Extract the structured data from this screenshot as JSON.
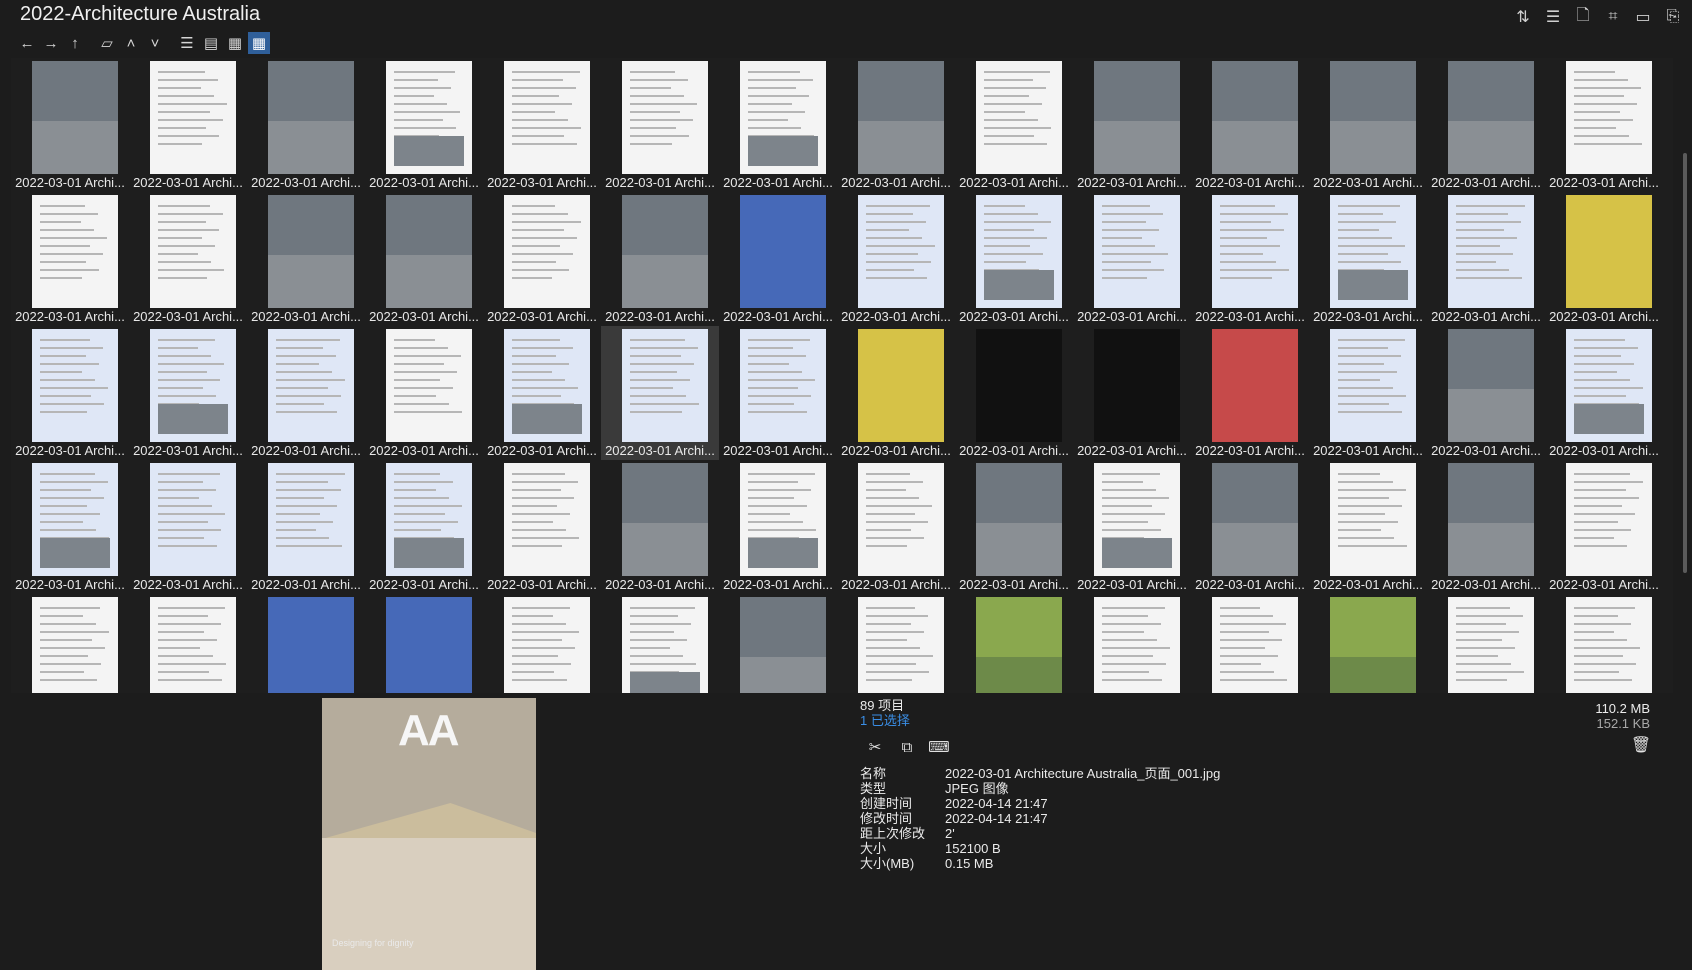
{
  "window": {
    "title": "2022-Architecture Australia",
    "controls": [
      "sort-icon",
      "list-properties-icon",
      "new-file-icon",
      "crop-icon",
      "panel-icon",
      "clipboard-icon"
    ]
  },
  "toolbar": {
    "buttons": [
      "back-arrow-icon",
      "forward-arrow-icon",
      "up-arrow-icon",
      "folder-icon",
      "chevron-up-icon",
      "chevron-down-icon",
      "list-view-icon",
      "detail-view-icon",
      "tree-view-icon",
      "thumbnail-view-icon"
    ]
  },
  "grid": {
    "label": "2022-03-01 Archi...",
    "rows": [
      [
        "photo",
        "white",
        "photo",
        "white",
        "white",
        "white",
        "white",
        "photo",
        "white",
        "photo",
        "photo",
        "photo",
        "photo",
        "white"
      ],
      [
        "white",
        "white",
        "photo",
        "photo",
        "white",
        "photo",
        "navy",
        "blue",
        "blue",
        "blue",
        "blue",
        "blue",
        "blue",
        "yellow"
      ],
      [
        "blue",
        "blue",
        "blue",
        "white",
        "blue",
        "blue",
        "blue",
        "yellow",
        "dark",
        "dark",
        "red",
        "blue",
        "photo",
        "blue"
      ],
      [
        "blue",
        "blue",
        "blue",
        "blue",
        "white",
        "photo",
        "white",
        "white",
        "photo",
        "white",
        "photo",
        "white",
        "photo",
        "white"
      ],
      [
        "white",
        "white",
        "navy",
        "navy",
        "white",
        "white",
        "photo",
        "white",
        "green",
        "white",
        "white",
        "green",
        "white",
        "white"
      ]
    ],
    "visible_labels_rows": 4,
    "selected": {
      "row": 2,
      "col": 5
    }
  },
  "preview": {
    "logo": "AA",
    "caption": "Designing for dignity"
  },
  "info": {
    "count": "89 项目",
    "selected": "1 已选择",
    "total_size": "110.2 MB",
    "selected_size": "152.1 KB"
  },
  "actions": [
    "cut-icon",
    "copy-icon",
    "rename-icon"
  ],
  "properties": [
    {
      "key": "名称",
      "value": "2022-03-01 Architecture Australia_页面_001.jpg"
    },
    {
      "key": "类型",
      "value": "JPEG 图像"
    },
    {
      "key": "创建时间",
      "value": "2022-04-14  21:47"
    },
    {
      "key": "修改时间",
      "value": "2022-04-14  21:47"
    },
    {
      "key": "距上次修改",
      "value": "2'"
    },
    {
      "key": "大小",
      "value": "152100 B"
    },
    {
      "key": "大小(MB)",
      "value": "0.15 MB"
    }
  ]
}
